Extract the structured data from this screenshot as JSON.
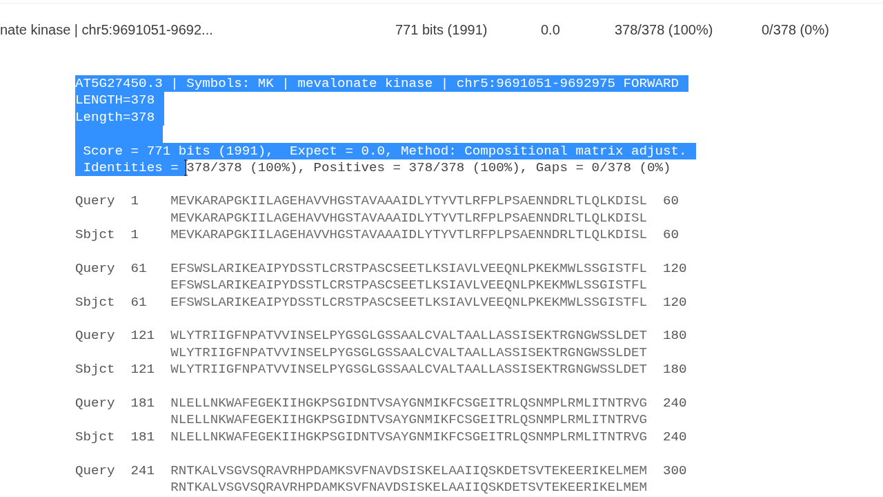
{
  "summary_row": {
    "description": "nate kinase | chr5:9691051-9692...",
    "score": "771 bits (1991)",
    "expect": "0.0",
    "identities": "378/378 (100%)",
    "gaps": "0/378 (0%)"
  },
  "hit_header": [
    {
      "kind": "text",
      "segments": [
        {
          "text": "AT5G27450.3 | Symbols: MK | mevalonate kinase | chr5:9691051-9692975 FORWARD",
          "selected": true
        }
      ]
    },
    {
      "kind": "text",
      "segments": [
        {
          "text": "LENGTH=378",
          "selected": true
        }
      ]
    },
    {
      "kind": "text",
      "segments": [
        {
          "text": "Length=378",
          "selected": true
        }
      ]
    },
    {
      "kind": "blank",
      "selected": true
    },
    {
      "kind": "text",
      "segments": [
        {
          "text": " Score = 771 bits (1991),  Expect = 0.0, Method: Compositional matrix adjust.",
          "selected": true
        }
      ]
    },
    {
      "kind": "text",
      "segments": [
        {
          "text": " Identities = ",
          "selected": true
        },
        {
          "text": "378/378 (100%), Positives = 378/378 (100%), Gaps = 0/378 (0%)",
          "selected": false
        }
      ],
      "cursor": true
    }
  ],
  "alignment_blocks": [
    {
      "rows": [
        {
          "label": "Query",
          "start": "1",
          "seq": "MEVKARAPGKIILAGEHAVVHGSTAVAAAIDLYTYVTLRFPLPSAENNDRLTLQLKDISL",
          "end": "60"
        },
        {
          "label": "",
          "start": "",
          "seq": "MEVKARAPGKIILAGEHAVVHGSTAVAAAIDLYTYVTLRFPLPSAENNDRLTLQLKDISL",
          "end": ""
        },
        {
          "label": "Sbjct",
          "start": "1",
          "seq": "MEVKARAPGKIILAGEHAVVHGSTAVAAAIDLYTYVTLRFPLPSAENNDRLTLQLKDISL",
          "end": "60"
        }
      ]
    },
    {
      "rows": [
        {
          "label": "Query",
          "start": "61",
          "seq": "EFSWSLARIKEAIPYDSSTLCRSTPASCSEETLKSIAVLVEEQNLPKEKMWLSSGISTFL",
          "end": "120"
        },
        {
          "label": "",
          "start": "",
          "seq": "EFSWSLARIKEAIPYDSSTLCRSTPASCSEETLKSIAVLVEEQNLPKEKMWLSSGISTFL",
          "end": ""
        },
        {
          "label": "Sbjct",
          "start": "61",
          "seq": "EFSWSLARIKEAIPYDSSTLCRSTPASCSEETLKSIAVLVEEQNLPKEKMWLSSGISTFL",
          "end": "120"
        }
      ]
    },
    {
      "rows": [
        {
          "label": "Query",
          "start": "121",
          "seq": "WLYTRIIGFNPATVVINSELPYGSGLGSSAALCVALTAALLASSISEKTRGNGWSSLDET",
          "end": "180"
        },
        {
          "label": "",
          "start": "",
          "seq": "WLYTRIIGFNPATVVINSELPYGSGLGSSAALCVALTAALLASSISEKTRGNGWSSLDET",
          "end": ""
        },
        {
          "label": "Sbjct",
          "start": "121",
          "seq": "WLYTRIIGFNPATVVINSELPYGSGLGSSAALCVALTAALLASSISEKTRGNGWSSLDET",
          "end": "180"
        }
      ]
    },
    {
      "rows": [
        {
          "label": "Query",
          "start": "181",
          "seq": "NLELLNKWAFEGEKIIHGKPSGIDNTVSAYGNMIKFCSGEITRLQSNMPLRMLITNTRVG",
          "end": "240"
        },
        {
          "label": "",
          "start": "",
          "seq": "NLELLNKWAFEGEKIIHGKPSGIDNTVSAYGNMIKFCSGEITRLQSNMPLRMLITNTRVG",
          "end": ""
        },
        {
          "label": "Sbjct",
          "start": "181",
          "seq": "NLELLNKWAFEGEKIIHGKPSGIDNTVSAYGNMIKFCSGEITRLQSNMPLRMLITNTRVG",
          "end": "240"
        }
      ]
    },
    {
      "rows": [
        {
          "label": "Query",
          "start": "241",
          "seq": "RNTKALVSGVSQRAVRHPDAMKSVFNAVDSISKELAAIIQSKDETSVTEKEERIKELMEM",
          "end": "300"
        },
        {
          "label": "",
          "start": "",
          "seq": "RNTKALVSGVSQRAVRHPDAMKSVFNAVDSISKELAAIIQSKDETSVTEKEERIKELMEM",
          "end": ""
        }
      ]
    }
  ]
}
